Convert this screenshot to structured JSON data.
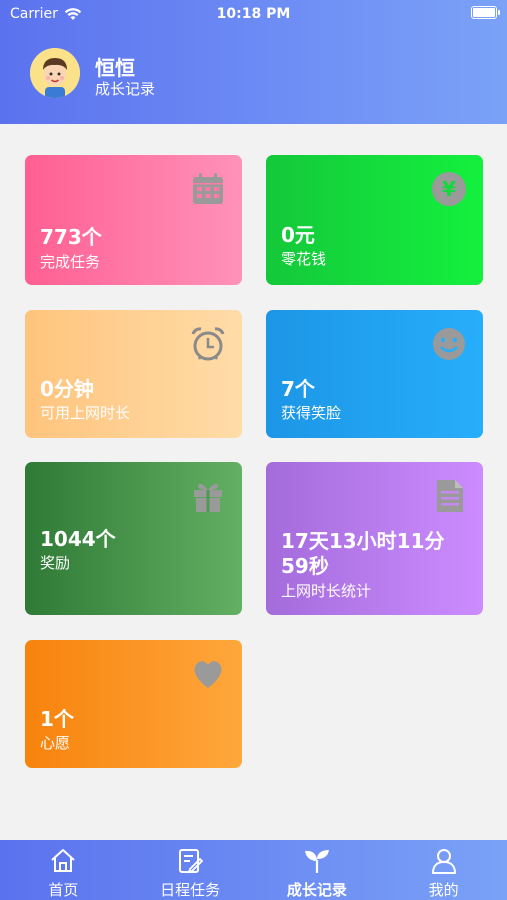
{
  "status_bar": {
    "carrier": "Carrier",
    "time": "10:18 PM"
  },
  "profile": {
    "name": "恒恒",
    "subtitle": "成长记录"
  },
  "cards": [
    {
      "value": "773个",
      "label": "完成任务",
      "icon": "calendar-icon"
    },
    {
      "value": "0元",
      "label": "零花钱",
      "icon": "money-icon"
    },
    {
      "value": "0分钟",
      "label": "可用上网时长",
      "icon": "alarm-clock-icon"
    },
    {
      "value": "7个",
      "label": "获得笑脸",
      "icon": "smiley-icon"
    },
    {
      "value": "1044个",
      "label": "奖励",
      "icon": "gift-icon"
    },
    {
      "value_line1": "17天13小时11分",
      "value_line2": "59秒",
      "label": "上网时长统计",
      "icon": "document-icon"
    },
    {
      "value": "1个",
      "label": "心愿",
      "icon": "heart-icon"
    }
  ],
  "tabbar": {
    "items": [
      {
        "label": "首页",
        "icon": "home-icon"
      },
      {
        "label": "日程任务",
        "icon": "edit-icon"
      },
      {
        "label": "成长记录",
        "icon": "sprout-icon",
        "active": true
      },
      {
        "label": "我的",
        "icon": "person-icon"
      }
    ]
  },
  "colors": {
    "header": "#5b72ee",
    "icon_gray": "#9a9a9a"
  }
}
